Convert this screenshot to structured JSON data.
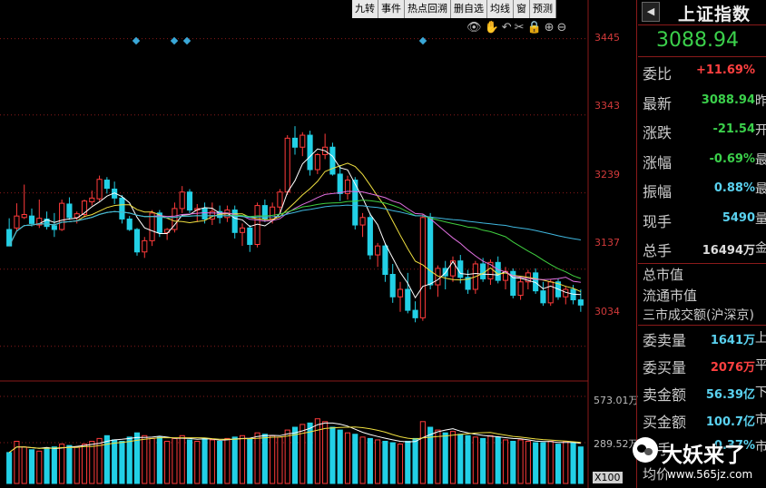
{
  "toolbar": {
    "buttons": [
      "九转",
      "事件",
      "热点回溯",
      "删自选",
      "均线",
      "窗",
      "预测"
    ]
  },
  "chart_tools": {
    "icons": [
      "eye-icon",
      "hand-icon",
      "undo-icon",
      "scissors-icon",
      "lock-icon",
      "zoom-in-icon",
      "zoom-out-icon"
    ],
    "glyphs": "👁✋↶✂🔒⊕⊖"
  },
  "price_axis": [
    "3445",
    "3343",
    "3239",
    "3137",
    "3034"
  ],
  "volume_axis": {
    "top": "573.01万",
    "mid": "289.52万",
    "unit": "X100"
  },
  "colors": {
    "up": "#ff3b3b",
    "down": "#22d0e6",
    "background": "#000000",
    "grid": "#8a1a1a"
  },
  "quote": {
    "title": "上证指数",
    "price": "3088.94",
    "rows": [
      {
        "label": "委比",
        "value": "+11.69%",
        "color": "#ff4040",
        "tail": ""
      },
      {
        "label": "最新",
        "value": "3088.94",
        "color": "#3bd04b",
        "tail": "昨"
      },
      {
        "label": "涨跌",
        "value": "-21.54",
        "color": "#3bd04b",
        "tail": "开"
      },
      {
        "label": "涨幅",
        "value": "-0.69%",
        "color": "#3bd04b",
        "tail": "最"
      },
      {
        "label": "振幅",
        "value": "0.88%",
        "color": "#5ad2f0",
        "tail": "最"
      },
      {
        "label": "现手",
        "value": "5490",
        "color": "#5ad2f0",
        "tail": "量"
      },
      {
        "label": "总手",
        "value": "16494万",
        "color": "#dddddd",
        "tail": "金"
      }
    ],
    "info_labels": [
      "总市值",
      "流通市值",
      "三市成交额(沪深京)"
    ],
    "rows2": [
      {
        "label": "委卖量",
        "value": "1641万",
        "color": "#5ad2f0",
        "tail": "上"
      },
      {
        "label": "委买量",
        "value": "2076万",
        "color": "#ff4040",
        "tail": "平"
      },
      {
        "label": "卖金额",
        "value": "56.39亿",
        "color": "#5ad2f0",
        "tail": "下"
      },
      {
        "label": "买金额",
        "value": "100.7亿",
        "color": "#5ad2f0",
        "tail": "市"
      },
      {
        "label": "换手",
        "value": "0.37%",
        "color": "#5ad2f0",
        "tail": "市"
      }
    ],
    "last_label": "均价"
  },
  "watermark": {
    "text": "大妖来了",
    "url": "www.565jz.com"
  },
  "chart_data": {
    "type": "candlestick",
    "y_range": [
      2990,
      3470
    ],
    "volume_range": [
      0,
      600
    ],
    "candles": [
      [
        3190,
        3205,
        3175,
        3168
      ],
      [
        3192,
        3225,
        3188,
        3208
      ],
      [
        3206,
        3250,
        3204,
        3210
      ],
      [
        3208,
        3218,
        3194,
        3198
      ],
      [
        3196,
        3230,
        3192,
        3205
      ],
      [
        3204,
        3214,
        3190,
        3194
      ],
      [
        3195,
        3212,
        3180,
        3190
      ],
      [
        3190,
        3230,
        3188,
        3225
      ],
      [
        3224,
        3233,
        3203,
        3206
      ],
      [
        3206,
        3214,
        3198,
        3211
      ],
      [
        3210,
        3230,
        3206,
        3228
      ],
      [
        3227,
        3242,
        3222,
        3232
      ],
      [
        3231,
        3262,
        3228,
        3257
      ],
      [
        3256,
        3260,
        3238,
        3245
      ],
      [
        3244,
        3254,
        3224,
        3232
      ],
      [
        3232,
        3236,
        3198,
        3204
      ],
      [
        3204,
        3208,
        3188,
        3190
      ],
      [
        3190,
        3192,
        3155,
        3160
      ],
      [
        3160,
        3180,
        3152,
        3175
      ],
      [
        3175,
        3216,
        3168,
        3212
      ],
      [
        3212,
        3216,
        3180,
        3186
      ],
      [
        3186,
        3192,
        3176,
        3190
      ],
      [
        3190,
        3226,
        3186,
        3218
      ],
      [
        3218,
        3248,
        3212,
        3240
      ],
      [
        3240,
        3244,
        3212,
        3216
      ],
      [
        3216,
        3224,
        3200,
        3218
      ],
      [
        3218,
        3226,
        3198,
        3204
      ],
      [
        3204,
        3226,
        3196,
        3214
      ],
      [
        3214,
        3222,
        3198,
        3206
      ],
      [
        3206,
        3222,
        3200,
        3216
      ],
      [
        3216,
        3222,
        3178,
        3186
      ],
      [
        3186,
        3198,
        3168,
        3192
      ],
      [
        3192,
        3196,
        3160,
        3170
      ],
      [
        3170,
        3226,
        3166,
        3222
      ],
      [
        3222,
        3230,
        3200,
        3204
      ],
      [
        3204,
        3226,
        3198,
        3220
      ],
      [
        3220,
        3244,
        3212,
        3240
      ],
      [
        3240,
        3316,
        3236,
        3312
      ],
      [
        3312,
        3328,
        3290,
        3300
      ],
      [
        3300,
        3320,
        3288,
        3316
      ],
      [
        3316,
        3322,
        3262,
        3270
      ],
      [
        3270,
        3292,
        3264,
        3290
      ],
      [
        3290,
        3318,
        3284,
        3300
      ],
      [
        3300,
        3306,
        3262,
        3264
      ],
      [
        3264,
        3276,
        3228,
        3238
      ],
      [
        3238,
        3262,
        3230,
        3256
      ],
      [
        3256,
        3260,
        3190,
        3196
      ],
      [
        3196,
        3212,
        3180,
        3206
      ],
      [
        3206,
        3212,
        3150,
        3156
      ],
      [
        3156,
        3172,
        3140,
        3168
      ],
      [
        3168,
        3172,
        3120,
        3130
      ],
      [
        3130,
        3144,
        3092,
        3100
      ],
      [
        3100,
        3120,
        3080,
        3110
      ],
      [
        3110,
        3132,
        3078,
        3082
      ],
      [
        3082,
        3094,
        3066,
        3072
      ],
      [
        3072,
        3210,
        3068,
        3206
      ],
      [
        3206,
        3212,
        3110,
        3116
      ],
      [
        3116,
        3142,
        3100,
        3138
      ],
      [
        3138,
        3148,
        3110,
        3128
      ],
      [
        3128,
        3154,
        3120,
        3148
      ],
      [
        3148,
        3156,
        3118,
        3126
      ],
      [
        3126,
        3136,
        3104,
        3110
      ],
      [
        3110,
        3148,
        3104,
        3144
      ],
      [
        3144,
        3152,
        3120,
        3124
      ],
      [
        3124,
        3150,
        3116,
        3146
      ],
      [
        3146,
        3154,
        3118,
        3122
      ],
      [
        3122,
        3140,
        3110,
        3134
      ],
      [
        3134,
        3138,
        3098,
        3102
      ],
      [
        3102,
        3126,
        3096,
        3120
      ],
      [
        3120,
        3136,
        3110,
        3132
      ],
      [
        3132,
        3138,
        3104,
        3108
      ],
      [
        3108,
        3120,
        3088,
        3092
      ],
      [
        3092,
        3124,
        3088,
        3120
      ],
      [
        3120,
        3124,
        3096,
        3100
      ],
      [
        3100,
        3114,
        3090,
        3110
      ],
      [
        3110,
        3116,
        3090,
        3096
      ],
      [
        3096,
        3110,
        3080,
        3089
      ]
    ],
    "volumes": [
      220,
      300,
      260,
      240,
      230,
      250,
      260,
      280,
      270,
      260,
      280,
      300,
      320,
      340,
      310,
      300,
      330,
      360,
      340,
      320,
      330,
      300,
      320,
      340,
      310,
      300,
      320,
      310,
      300,
      320,
      330,
      340,
      320,
      360,
      350,
      340,
      330,
      380,
      400,
      420,
      430,
      460,
      440,
      400,
      380,
      360,
      350,
      330,
      320,
      310,
      300,
      290,
      280,
      300,
      320,
      440,
      400,
      380,
      360,
      370,
      350,
      340,
      330,
      320,
      340,
      330,
      310,
      300,
      310,
      300,
      290,
      290,
      300,
      280,
      300,
      290,
      260
    ]
  }
}
